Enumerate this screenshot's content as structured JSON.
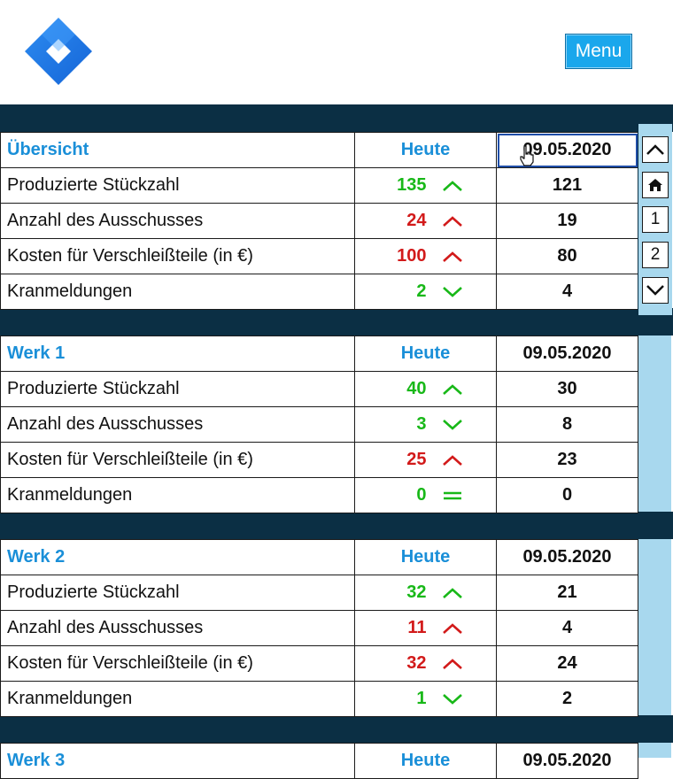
{
  "menu_label": "Menu",
  "nav": {
    "page1": "1",
    "page2": "2"
  },
  "sections": [
    {
      "title": "Übersicht",
      "today": "Heute",
      "date": "09.05.2020",
      "rows": [
        {
          "label": "Produzierte Stückzahl",
          "today": "135",
          "prev": "121",
          "trend": "up",
          "color": "#18b818"
        },
        {
          "label": "Anzahl des Ausschusses",
          "today": "24",
          "prev": "19",
          "trend": "up",
          "color": "#d21a1a"
        },
        {
          "label": "Kosten für Verschleißteile (in €)",
          "today": "100",
          "prev": "80",
          "trend": "up",
          "color": "#d21a1a"
        },
        {
          "label": "Kranmeldungen",
          "today": "2",
          "prev": "4",
          "trend": "down",
          "color": "#18b818"
        }
      ]
    },
    {
      "title": "Werk 1",
      "today": "Heute",
      "date": "09.05.2020",
      "rows": [
        {
          "label": "Produzierte Stückzahl",
          "today": "40",
          "prev": "30",
          "trend": "up",
          "color": "#18b818"
        },
        {
          "label": "Anzahl des Ausschusses",
          "today": "3",
          "prev": "8",
          "trend": "down",
          "color": "#18b818"
        },
        {
          "label": "Kosten für Verschleißteile (in €)",
          "today": "25",
          "prev": "23",
          "trend": "up",
          "color": "#d21a1a"
        },
        {
          "label": "Kranmeldungen",
          "today": "0",
          "prev": "0",
          "trend": "equal",
          "color": "#18b818"
        }
      ]
    },
    {
      "title": "Werk 2",
      "today": "Heute",
      "date": "09.05.2020",
      "rows": [
        {
          "label": "Produzierte Stückzahl",
          "today": "32",
          "prev": "21",
          "trend": "up",
          "color": "#18b818"
        },
        {
          "label": "Anzahl des Ausschusses",
          "today": "11",
          "prev": "4",
          "trend": "up",
          "color": "#d21a1a"
        },
        {
          "label": "Kosten für Verschleißteile (in €)",
          "today": "32",
          "prev": "24",
          "trend": "up",
          "color": "#d21a1a"
        },
        {
          "label": "Kranmeldungen",
          "today": "1",
          "prev": "2",
          "trend": "down",
          "color": "#18b818"
        }
      ]
    },
    {
      "title": "Werk 3",
      "today": "Heute",
      "date": "09.05.2020",
      "rows": []
    }
  ]
}
